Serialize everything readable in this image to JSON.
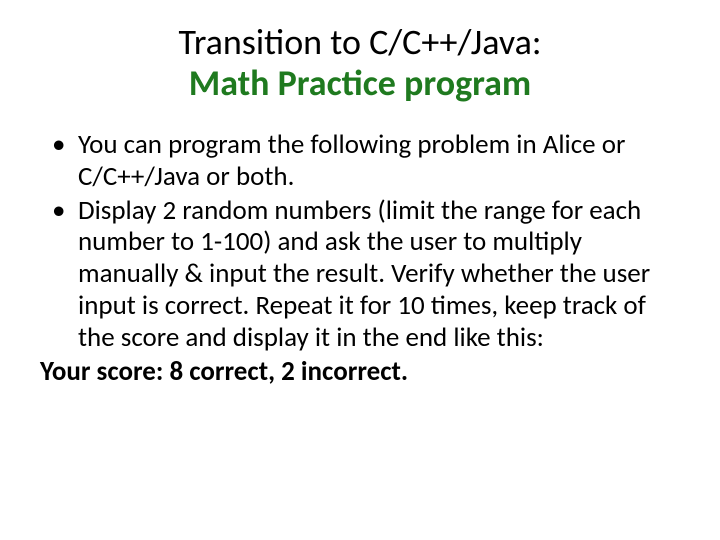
{
  "title": {
    "line1": "Transition to C/C++/Java:",
    "line2": "Math Practice program"
  },
  "bullets": [
    "You can program the following problem in Alice or C/C++/Java or both.",
    "Display 2 random numbers (limit the range for each number to 1-100) and ask the user to multiply manually & input the result. Verify whether the user input is correct. Repeat it for 10 times, keep track of the score and display it in the end like this:"
  ],
  "score_line": "Your score: 8 correct, 2 incorrect."
}
